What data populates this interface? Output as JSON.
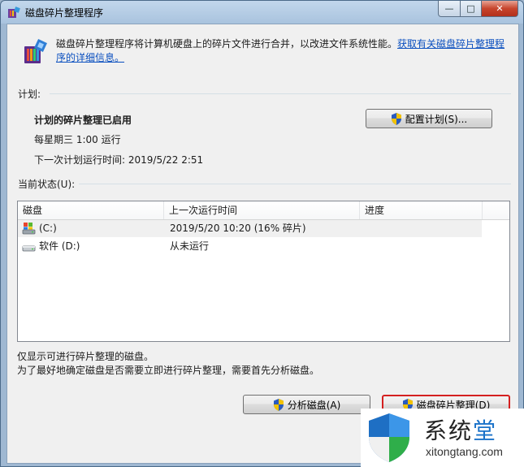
{
  "window": {
    "title": "磁盘碎片整理程序",
    "minimize_glyph": "—",
    "maximize_glyph": "□",
    "close_glyph": "✕"
  },
  "description": {
    "text": "磁盘碎片整理程序将计算机硬盘上的碎片文件进行合并，以改进文件系统性能。",
    "link": "获取有关磁盘碎片整理程序的详细信息。"
  },
  "schedule": {
    "section_label": "计划:",
    "status": "计划的碎片整理已启用",
    "frequency": "每星期三  1:00 运行",
    "next_run": "下一次计划运行时间: 2019/5/22 2:51",
    "configure_button": "配置计划(S)..."
  },
  "current_status": {
    "section_label": "当前状态(U):",
    "columns": [
      "磁盘",
      "上一次运行时间",
      "进度"
    ],
    "rows": [
      {
        "disk": "(C:)",
        "last_run": "2019/5/20 10:20 (16% 碎片)",
        "progress": ""
      },
      {
        "disk": "软件 (D:)",
        "last_run": "从未运行",
        "progress": ""
      }
    ]
  },
  "notes": {
    "line1": "仅显示可进行碎片整理的磁盘。",
    "line2": "为了最好地确定磁盘是否需要立即进行碎片整理，需要首先分析磁盘。"
  },
  "buttons": {
    "analyze": "分析磁盘(A)",
    "defragment": "磁盘碎片整理(D)"
  },
  "watermark": {
    "brand_a": "系统",
    "brand_b": "堂",
    "url": "xitongtang.com"
  },
  "colors": {
    "link": "#0a4fbf",
    "close_button": "#c7452d",
    "watermark_accent": "#1a72c9"
  }
}
